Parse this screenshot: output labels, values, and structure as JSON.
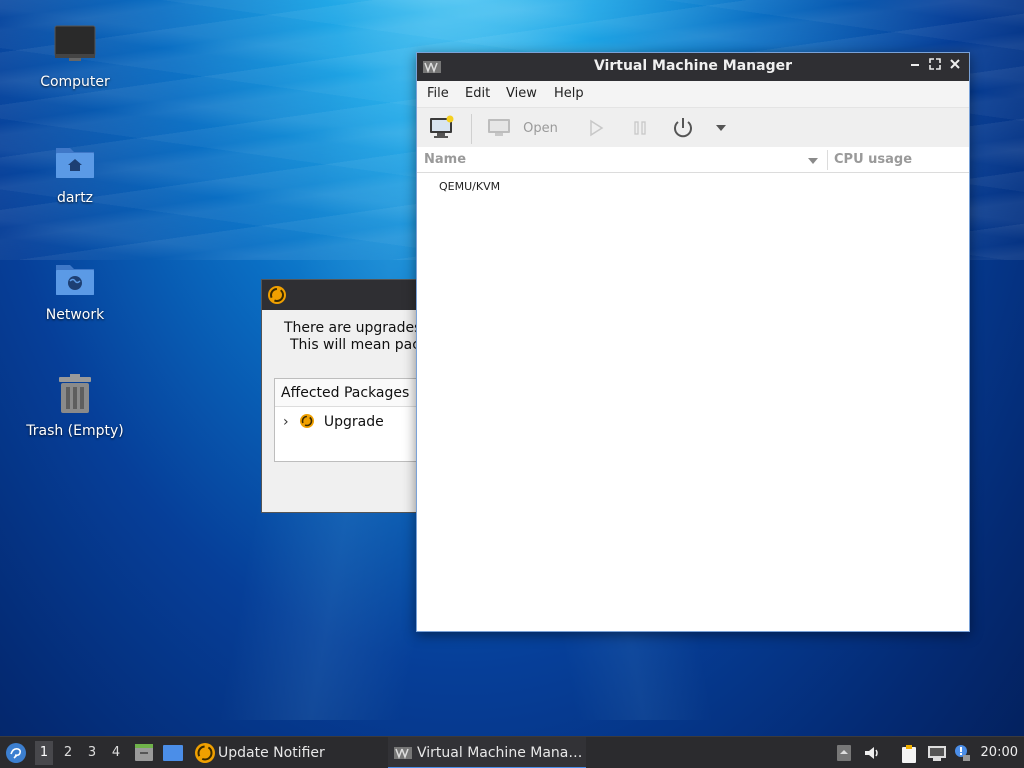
{
  "desktop": {
    "icons": [
      {
        "label": "Computer",
        "icon": "monitor-icon"
      },
      {
        "label": "dartz",
        "icon": "home-folder-icon"
      },
      {
        "label": "Network",
        "icon": "network-folder-icon"
      },
      {
        "label": "Trash (Empty)",
        "icon": "trash-icon"
      }
    ]
  },
  "update_dialog": {
    "line1": "There are upgrades",
    "line2": "This will mean pack",
    "list_header": "Affected Packages",
    "row_label": "Upgrade"
  },
  "vmm": {
    "title": "Virtual Machine Manager",
    "menu": {
      "file": "File",
      "edit": "Edit",
      "view": "View",
      "help": "Help"
    },
    "toolbar": {
      "open_label": "Open"
    },
    "columns": {
      "name": "Name",
      "cpu": "CPU usage"
    },
    "connections": [
      "QEMU/KVM"
    ]
  },
  "taskbar": {
    "workspaces": [
      "1",
      "2",
      "3",
      "4"
    ],
    "active_workspace": "1",
    "tasks": [
      {
        "label": "Update Notifier"
      },
      {
        "label": "Virtual Machine Mana…"
      }
    ],
    "clock": "20:00"
  },
  "colors": {
    "accent": "#4b8ee8",
    "titlebar": "#2f2f33",
    "update_orange": "#f0a000"
  }
}
